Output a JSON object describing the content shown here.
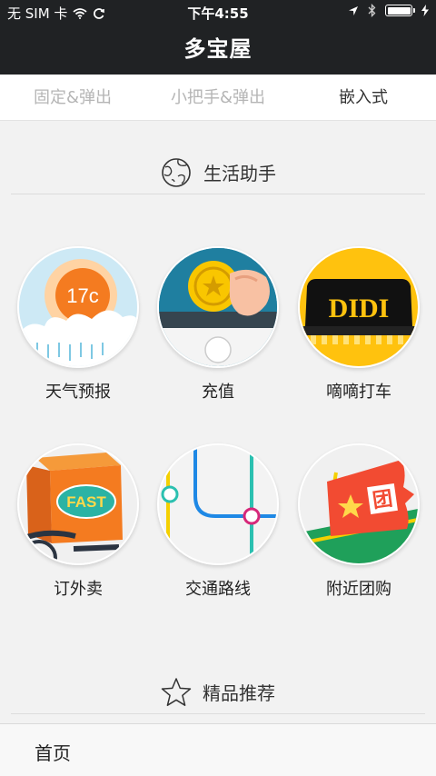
{
  "status_bar": {
    "carrier": "无 SIM 卡",
    "time": "下午4:55",
    "battery_level": 1.0,
    "icons": [
      "wifi-icon",
      "sync-icon",
      "location-arrow-icon",
      "bluetooth-icon",
      "battery-icon",
      "charging-icon"
    ]
  },
  "nav": {
    "title": "多宝屋"
  },
  "tabs": [
    {
      "label": "固定&弹出",
      "active": false
    },
    {
      "label": "小把手&弹出",
      "active": false
    },
    {
      "label": "嵌入式",
      "active": true
    }
  ],
  "sections": [
    {
      "title": "生活助手",
      "icon": "globe-icon",
      "items": [
        {
          "label": "天气预报",
          "icon": "weather-icon",
          "badge": "17c"
        },
        {
          "label": "充值",
          "icon": "recharge-coin-icon"
        },
        {
          "label": "嘀嘀打车",
          "icon": "taxi-sign-icon",
          "badge": "DIDI"
        },
        {
          "label": "订外卖",
          "icon": "delivery-box-icon",
          "badge": "FAST"
        },
        {
          "label": "交通路线",
          "icon": "transit-route-icon"
        },
        {
          "label": "附近团购",
          "icon": "group-buy-ticket-icon",
          "badge": "团"
        }
      ]
    },
    {
      "title": "精品推荐",
      "icon": "star-icon"
    }
  ],
  "bottom_bar": {
    "label": "首页"
  },
  "colors": {
    "header_bg": "#202224",
    "background": "#f2f2f2",
    "tab_inactive": "#b5b5b5",
    "tab_active": "#333333",
    "weather_orange": "#f47b20",
    "didi_yellow": "#ffc20e",
    "delivery_teal": "#2bb3a4",
    "group_buy_red": "#f24b32"
  }
}
